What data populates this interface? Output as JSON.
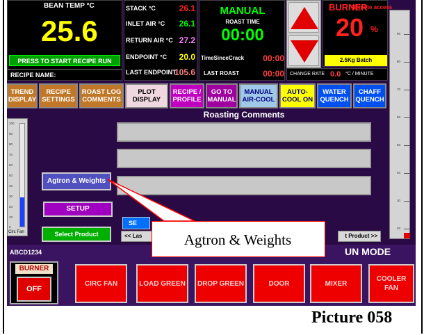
{
  "screen": {
    "bean_temp": {
      "label": "BEAN TEMP °C",
      "value": "25.6"
    },
    "start_recipe": "PRESS TO START RECIPE RUN",
    "recipe_name_label": "RECIPE NAME:",
    "readouts": [
      {
        "label": "STACK °C",
        "value": "26.1",
        "color": "#ff2020"
      },
      {
        "label": "INLET AIR °C",
        "value": "26.1",
        "color": "#00ff00"
      },
      {
        "label": "RETURN AIR °C",
        "value": "27.2",
        "color": "#ff80ff"
      },
      {
        "label": "ENDPOINT °C",
        "value": "20.0",
        "color": "#ffff00"
      },
      {
        "label": "LAST ENDPOINT",
        "value": "105.6",
        "color": "#ff8080"
      }
    ],
    "mode": "MANUAL",
    "roast_time": {
      "label": "ROAST TIME",
      "value": "00:00"
    },
    "time_since_crack": {
      "label": "TimeSinceCrack",
      "value": "00:00"
    },
    "last_roast": {
      "label": "LAST ROAST",
      "value": "00:00"
    },
    "burner": {
      "label": "BURNER",
      "value": "20",
      "unit": "%"
    },
    "remote_access": "Remote access",
    "batch": "2.5Kg Batch",
    "change_rate": {
      "label": "CHANGE RATE",
      "value": "0.0",
      "unit": "°C / MINUTE"
    },
    "tabs": [
      {
        "label": "TREND DISPLAY"
      },
      {
        "label": "RECIPE SETTINGS"
      },
      {
        "label": "ROAST LOG COMMENTS"
      },
      {
        "label": "PLOT DISPLAY"
      },
      {
        "label": "RECIPE / PROFILE"
      },
      {
        "label": "GO TO MANUAL"
      },
      {
        "label": "MANUAL AIR-COOL"
      },
      {
        "label": "AUTO-COOL ON"
      },
      {
        "label": "WATER QUENCH"
      },
      {
        "label": "CHAFF QUENCH"
      }
    ],
    "section_title": "Roasting Comments",
    "agtron_button": "Agtron & Weights",
    "setup_button": "SETUP",
    "select_product_button": "Select Product",
    "se_button": "SE",
    "prev_product": "<< Las",
    "next_product": "t Product >>",
    "left_gauge_label": "Circ Fan",
    "left_gauge_level": 0.28,
    "right_gauge_level": 0.02,
    "gauge_ticks": [
      "100",
      "90",
      "80",
      "70",
      "60",
      "50",
      "40",
      "30",
      "20",
      "10",
      "0"
    ],
    "right_ticks": [
      "90",
      "80",
      "70",
      "60",
      "50",
      "40",
      "30",
      "20"
    ],
    "product_code": "ABCD1234",
    "run_mode": "UN MODE",
    "bottom_buttons": [
      {
        "label": "CIRC FAN"
      },
      {
        "label": "LOAD GREEN"
      },
      {
        "label": "DROP GREEN"
      },
      {
        "label": "DOOR"
      },
      {
        "label": "MIXER"
      },
      {
        "label": "COOLER FAN"
      }
    ],
    "burner_toggle": {
      "top": "BURNER",
      "bottom": "OFF"
    }
  },
  "callout": "Agtron & Weights",
  "caption": "Picture 058"
}
